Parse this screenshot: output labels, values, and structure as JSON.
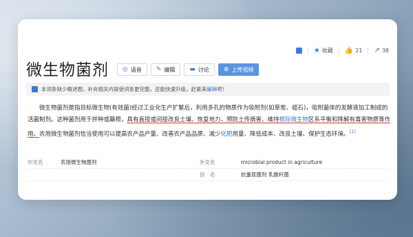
{
  "toolbar": {
    "collect_label": "收藏",
    "like_count": "21",
    "share_count": "38"
  },
  "entry": {
    "title": "微生物菌剂",
    "buttons": {
      "audio": "语音",
      "edit": "编辑",
      "discuss": "讨论",
      "upload_video": "上传视频"
    }
  },
  "notice": {
    "text": "本词条缺少概述图，补充相关内容使词条更完整，还能快速升级，赶紧来",
    "link": "编辑",
    "tail": "吧！"
  },
  "summary": {
    "part1": "微生物菌剂是指目标微生物(有效菌)经过工业化生产扩繁后，利用多孔的物质作为吸附剂(如草炭、蛭石)，吸附菌体的发酵液加工制成的活菌制剂。这种菌剂用于拌种或蘸根，",
    "underlined1": "具有直接或间接改良土壤、恢复地力、预防土传病害、维持",
    "link1": "根际微生物",
    "underlined2": "区系平衡和降解有毒害物质等作用。",
    "part2": "农用微生物菌剂恰当使用可以提高农产品产量、改善农产品品质、减少",
    "link2": "化肥",
    "part3": "用量、降低成本、改良土壤、保护生态环境。",
    "ref": "[1]"
  },
  "basic_info": [
    {
      "key": "中文名",
      "value": "农用微生物菌剂",
      "key2": "外文名",
      "value2": "microbial product in agriculture"
    },
    {
      "key": "",
      "value": "",
      "key2": "别　名",
      "value2": "抗重茬菌剂 乳酸杆菌"
    }
  ]
}
